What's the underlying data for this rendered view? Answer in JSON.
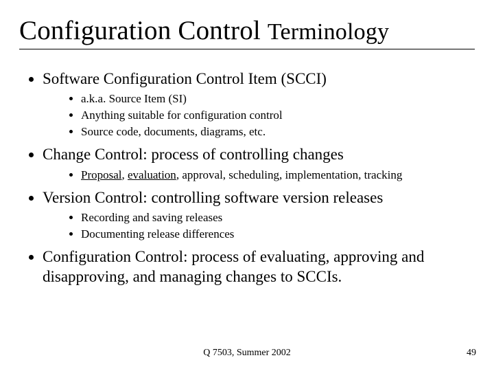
{
  "title_main": "Configuration Control ",
  "title_small": "Terminology",
  "bullets": {
    "b1": "Software Configuration Control Item (SCCI)",
    "b1_sub": {
      "s1": "a.k.a. Source Item (SI)",
      "s2": "Anything suitable for configuration control",
      "s3": "Source code, documents, diagrams, etc."
    },
    "b2": "Change Control: process of controlling changes",
    "b2_sub": {
      "s1_html": "<span class=\"u\">Proposal</span>, <span class=\"u\">evaluation</span>, approval, scheduling, implementation, tracking"
    },
    "b3": "Version Control: controlling software version releases",
    "b3_sub": {
      "s1": "Recording and saving releases",
      "s2": "Documenting release differences"
    },
    "b4": "Configuration Control: process of evaluating, approving and disapproving, and managing changes to SCCIs."
  },
  "footer_center": "Q 7503, Summer 2002",
  "footer_right": "49"
}
